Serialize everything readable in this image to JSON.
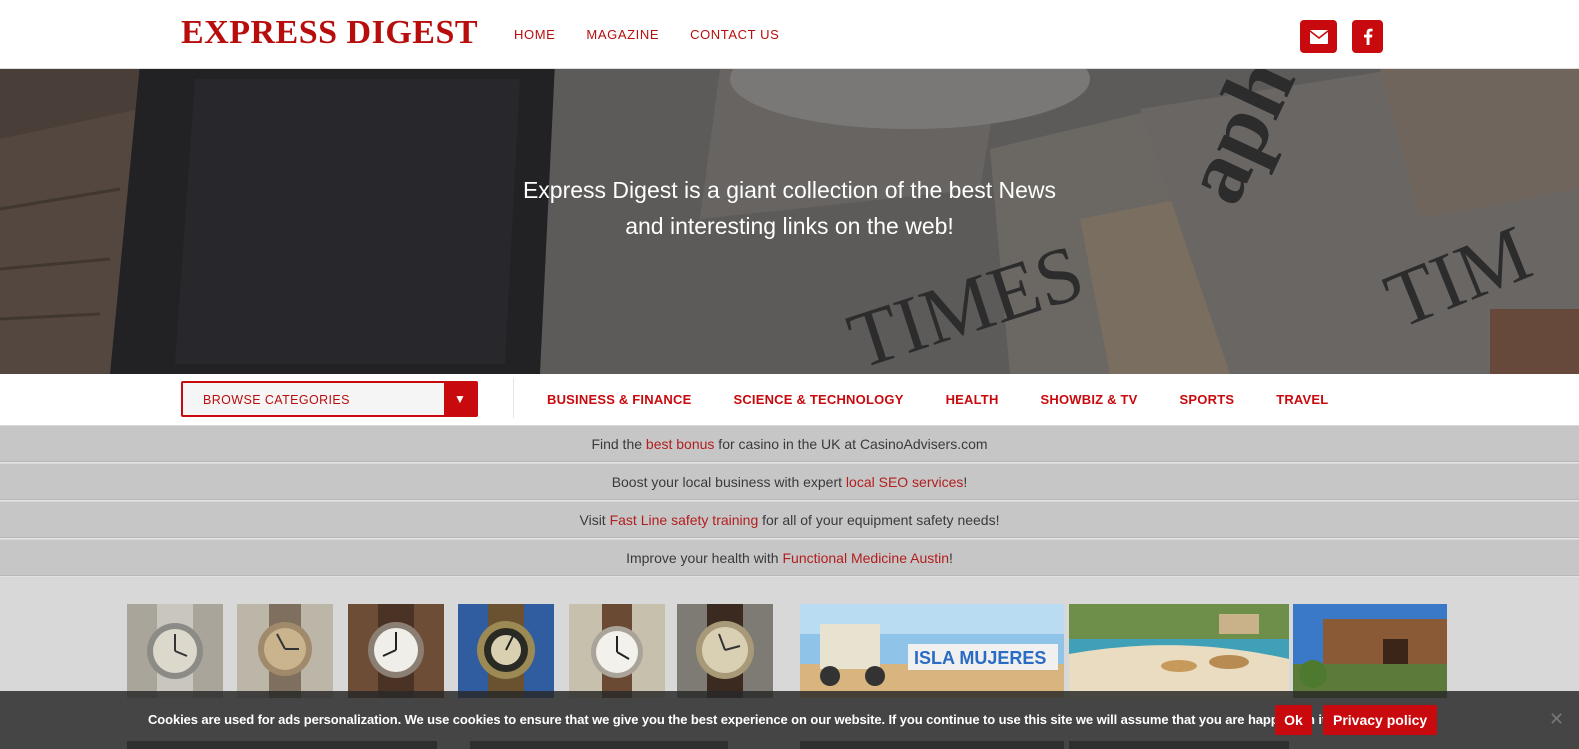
{
  "header": {
    "logo": "EXPRESS DIGEST",
    "nav": [
      "HOME",
      "MAGAZINE",
      "CONTACT US"
    ],
    "social": [
      {
        "icon": "envelope-icon"
      },
      {
        "icon": "facebook-icon"
      }
    ]
  },
  "hero": {
    "line1": "Express Digest is a giant collection of the best News",
    "line2": "and interesting links on the web!"
  },
  "categories": {
    "browse_label": "BROWSE CATEGORIES",
    "items": [
      "BUSINESS & FINANCE",
      "SCIENCE & TECHNOLOGY",
      "HEALTH",
      "SHOWBIZ & TV",
      "SPORTS",
      "TRAVEL"
    ]
  },
  "promos": [
    {
      "before": "Find the ",
      "link": "best bonus",
      "after": " for casino in the UK at CasinoAdvisers.com"
    },
    {
      "before": "Boost your local business with expert ",
      "link": "local SEO services",
      "after": "!"
    },
    {
      "before": "Visit ",
      "link": "Fast Line safety training",
      "after": " for all of your equipment safety needs!"
    },
    {
      "before": "Improve your health with ",
      "link": "Functional Medicine Austin",
      "after": "!"
    }
  ],
  "gallery": {
    "isla_sign": "ISLA MUJERES"
  },
  "cookie": {
    "text": "Cookies are used for ads personalization. We use cookies to ensure that we give you the best experience on our website. If you continue to use this site we will assume that you are happy with it.",
    "ok": "Ok",
    "privacy": "Privacy policy",
    "close": "✕"
  },
  "colors": {
    "brand_red": "#c8090d",
    "logo_red": "#b80d0d",
    "promo_bg": "#c6c6c6"
  }
}
